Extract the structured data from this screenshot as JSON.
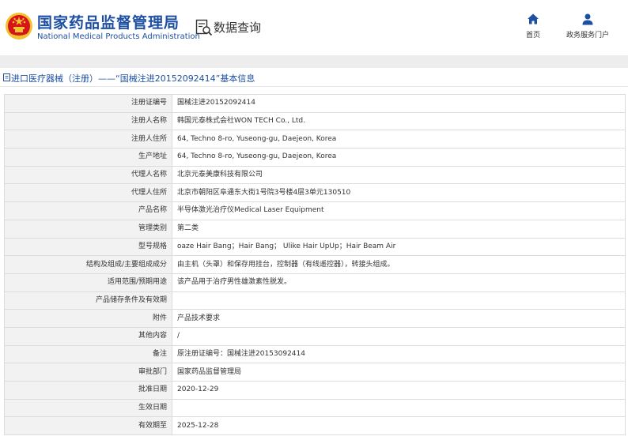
{
  "header": {
    "org_cn": "国家药品监督管理局",
    "org_en": "National Medical Products Administration",
    "section": "数据查询",
    "nav": [
      {
        "label": "首页",
        "icon": "home-icon"
      },
      {
        "label": "政务服务门户",
        "icon": "user-icon"
      }
    ]
  },
  "breadcrumb": {
    "text": "进口医疗器械（注册）——“国械注进20152092414”基本信息"
  },
  "details": [
    {
      "label": "注册证编号",
      "value": "国械注进20152092414"
    },
    {
      "label": "注册人名称",
      "value": "韩国元泰株式会社WON TECH Co., Ltd."
    },
    {
      "label": "注册人住所",
      "value": "64, Techno 8-ro, Yuseong-gu, Daejeon, Korea"
    },
    {
      "label": "生产地址",
      "value": "64, Techno 8-ro, Yuseong-gu, Daejeon, Korea"
    },
    {
      "label": "代理人名称",
      "value": "北京元泰美康科技有限公司"
    },
    {
      "label": "代理人住所",
      "value": "北京市朝阳区阜通东大街1号院3号楼4层3单元130510"
    },
    {
      "label": "产品名称",
      "value": "半导体激光治疗仪Medical Laser Equipment"
    },
    {
      "label": "管理类别",
      "value": "第二类"
    },
    {
      "label": "型号规格",
      "value": "oaze Hair Bang；Hair Bang； Ulike Hair UpUp；Hair Beam Air"
    },
    {
      "label": "结构及组成/主要组成成分",
      "value": "由主机（头罩）和保存用挂台，控制器（有线遥控器），转接头组成。"
    },
    {
      "label": "适用范围/预期用途",
      "value": "该产品用于治疗男性雄激素性脱发。"
    },
    {
      "label": "产品储存条件及有效期",
      "value": ""
    },
    {
      "label": "附件",
      "value": "产品技术要求"
    },
    {
      "label": "其他内容",
      "value": "/"
    },
    {
      "label": "备注",
      "value": "原注册证编号：国械注进20153092414"
    },
    {
      "label": "审批部门",
      "value": "国家药品监督管理局"
    },
    {
      "label": "批准日期",
      "value": "2020-12-29"
    },
    {
      "label": "生效日期",
      "value": ""
    },
    {
      "label": "有效期至",
      "value": "2025-12-28"
    }
  ],
  "colors": {
    "brand": "#1d4fa3",
    "label_bg": "#f2f2f2",
    "border": "#dcdcdc",
    "emblem_red": "#d7141a",
    "emblem_gold": "#f2c230"
  }
}
